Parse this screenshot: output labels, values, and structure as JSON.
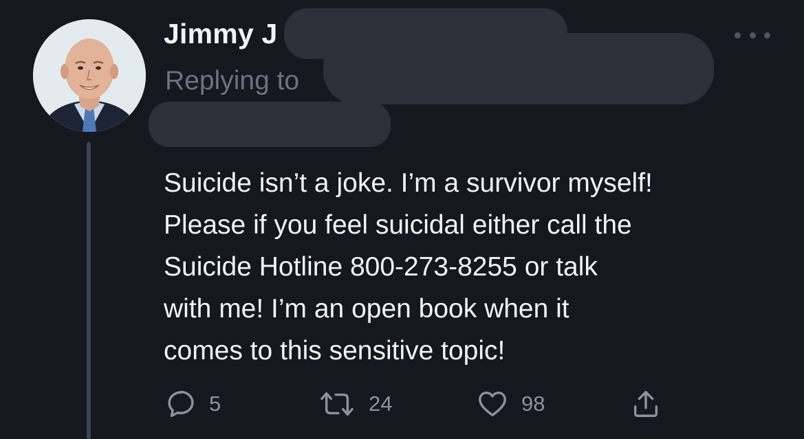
{
  "tweet": {
    "author_name": "Jimmy J",
    "replying_to_label": "Replying to",
    "text_lines": [
      "Suicide isn’t a joke. I’m a survivor myself!",
      "Please if you feel suicidal either call the",
      "Suicide Hotline 800-273-8255 or talk",
      "with me! I’m an open book when it",
      "comes to this sensitive topic!"
    ]
  },
  "actions": {
    "reply": {
      "icon": "reply-icon",
      "count": "5"
    },
    "retweet": {
      "icon": "retweet-icon",
      "count": "24"
    },
    "like": {
      "icon": "heart-icon",
      "count": "98"
    },
    "share": {
      "icon": "share-icon"
    }
  },
  "colors": {
    "background": "#14181f",
    "text": "#f2f4f5",
    "secondary_text": "#6b737e",
    "icon": "#8b939c",
    "redaction": "#2c3038"
  }
}
